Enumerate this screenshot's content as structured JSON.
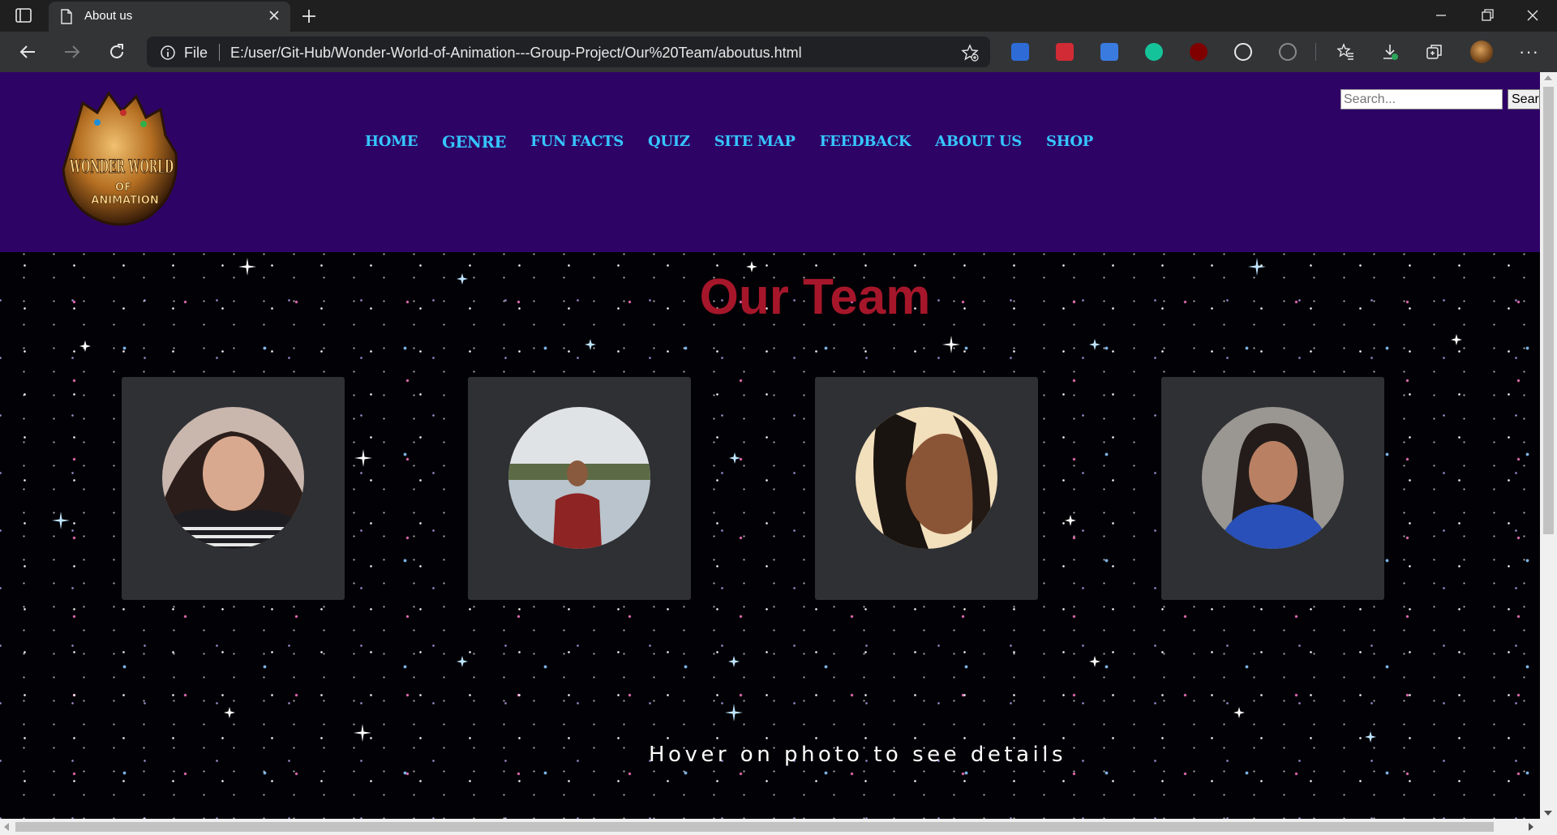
{
  "browser": {
    "tab_title": "About us",
    "address_scheme_label": "File",
    "url": "E:/user/Git-Hub/Wonder-World-of-Animation---Group-Project/Our%20Team/aboutus.html",
    "extensions": [
      {
        "name": "save-extension-icon",
        "color": "#2e6bd6"
      },
      {
        "name": "mendeley-extension-icon",
        "color": "#d12b36"
      },
      {
        "name": "gem-extension-icon",
        "color": "#3a7be0"
      },
      {
        "name": "grammarly-extension-icon",
        "color": "#15c39a"
      },
      {
        "name": "ublock-extension-icon",
        "color": "#800000"
      },
      {
        "name": "github-extension-icon",
        "color": "#e8e8e8"
      }
    ]
  },
  "site": {
    "logo_alt": "WONDER WORLD OF ANIMATION",
    "logo_text": [
      "WONDER WORLD",
      "OF",
      "ANIMATION"
    ],
    "nav": [
      "HOME",
      "GENRE",
      "FUN FACTS",
      "QUIZ",
      "SITE MAP",
      "FEEDBACK",
      "ABOUT US",
      "SHOP"
    ],
    "active_nav": "GENRE",
    "search": {
      "placeholder": "Search...",
      "button_label": "Search"
    },
    "colors": {
      "header_bg": "#2e0366",
      "nav_link": "#35c6ff",
      "title": "#a6162a",
      "card_bg": "#2e3034"
    }
  },
  "main": {
    "title": "Our Team",
    "team_photos": [
      "team-member-1-photo",
      "team-member-2-photo",
      "team-member-3-photo",
      "team-member-4-photo"
    ],
    "hint": "Hover on photo to see details"
  }
}
